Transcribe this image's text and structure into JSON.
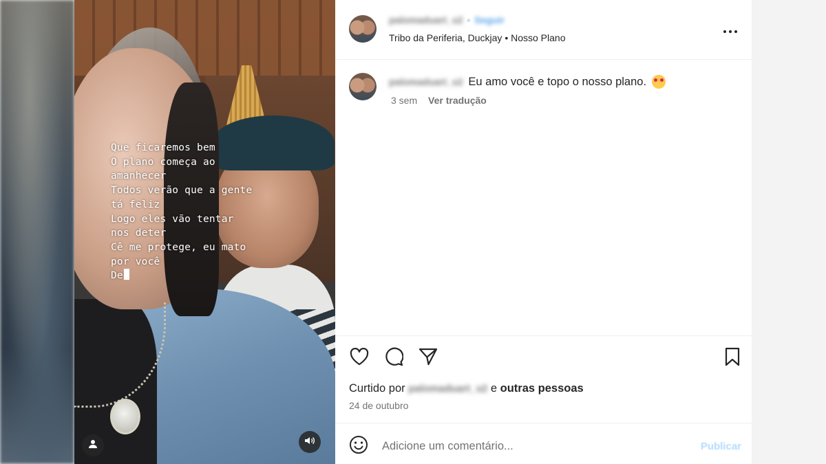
{
  "header": {
    "username": "palomaduart_s2",
    "follow_label": "Seguir",
    "audio_line": "Tribo da Periferia, Duckjay • Nosso Plano",
    "more_icon": "more-horizontal-icon"
  },
  "caption": {
    "username": "palomaduart_s2",
    "text": "Eu amo você e topo o nosso plano.",
    "emoji": "smiling-face-with-hearts",
    "age": "3 sem",
    "translate_label": "Ver tradução"
  },
  "video": {
    "lyrics": [
      "Que ficaremos bem",
      "O plano começa ao",
      "amanhecer",
      "Todos verão que a gente",
      "tá feliz",
      "Logo eles vão tentar",
      "nos deter",
      "Cê me protege, eu mato",
      "por você",
      "De"
    ],
    "user_icon": "user-tag-icon",
    "sound_icon": "speaker-icon"
  },
  "actions": {
    "like_icon": "heart-icon",
    "comment_icon": "comment-icon",
    "share_icon": "share-icon",
    "save_icon": "bookmark-icon"
  },
  "likes": {
    "prefix": "Curtido por",
    "username": "palomaduart_s2",
    "connector": "e",
    "others": "outras pessoas"
  },
  "date": "24 de outubro",
  "comment": {
    "placeholder": "Adicione um comentário...",
    "publish_label": "Publicar",
    "emoji_icon": "emoji-smile-icon"
  }
}
